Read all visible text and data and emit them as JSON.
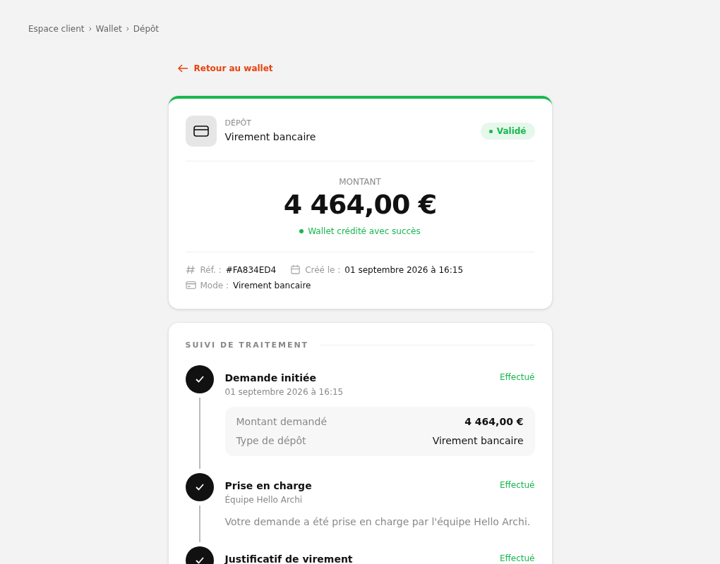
{
  "breadcrumb": [
    "Espace client",
    "Wallet",
    "Dépôt"
  ],
  "back_link": {
    "label": "Retour au wallet"
  },
  "deposit_card": {
    "eyebrow": "DÉPÔT",
    "title": "Virement bancaire",
    "status": {
      "label": "Validé",
      "color": "#16b84e"
    },
    "amount_label": "MONTANT",
    "amount": "4 464,00 €",
    "amount_note": "Wallet crédité avec succès",
    "meta": [
      {
        "kind": "ref",
        "label": "Réf. :",
        "value": "#FA834ED4"
      },
      {
        "kind": "date",
        "label": "Créé le :",
        "value": "01 septembre 2026 à 16:15"
      },
      {
        "kind": "mode",
        "label": "Mode :",
        "value": "Virement bancaire"
      }
    ]
  },
  "timeline": {
    "title": "SUIVI DE TRAITEMENT",
    "steps": [
      {
        "kind": "details",
        "done": true,
        "title": "Demande initiée",
        "subtitle": "01 septembre 2026 à 16:15",
        "status": "Effectué",
        "details": [
          {
            "label": "Montant demandé",
            "value": "4 464,00 €",
            "emphasis": true
          },
          {
            "label": "Type de dépôt",
            "value": "Virement bancaire",
            "emphasis": false
          }
        ]
      },
      {
        "kind": "note",
        "done": true,
        "title": "Prise en charge",
        "subtitle": "Équipe Hello Archi",
        "status": "Effectué",
        "note": "Votre demande a été prise en charge par l'équipe Hello Archi."
      },
      {
        "kind": "plain",
        "done": true,
        "title": "Justificatif de virement",
        "status": "Effectué"
      }
    ]
  }
}
